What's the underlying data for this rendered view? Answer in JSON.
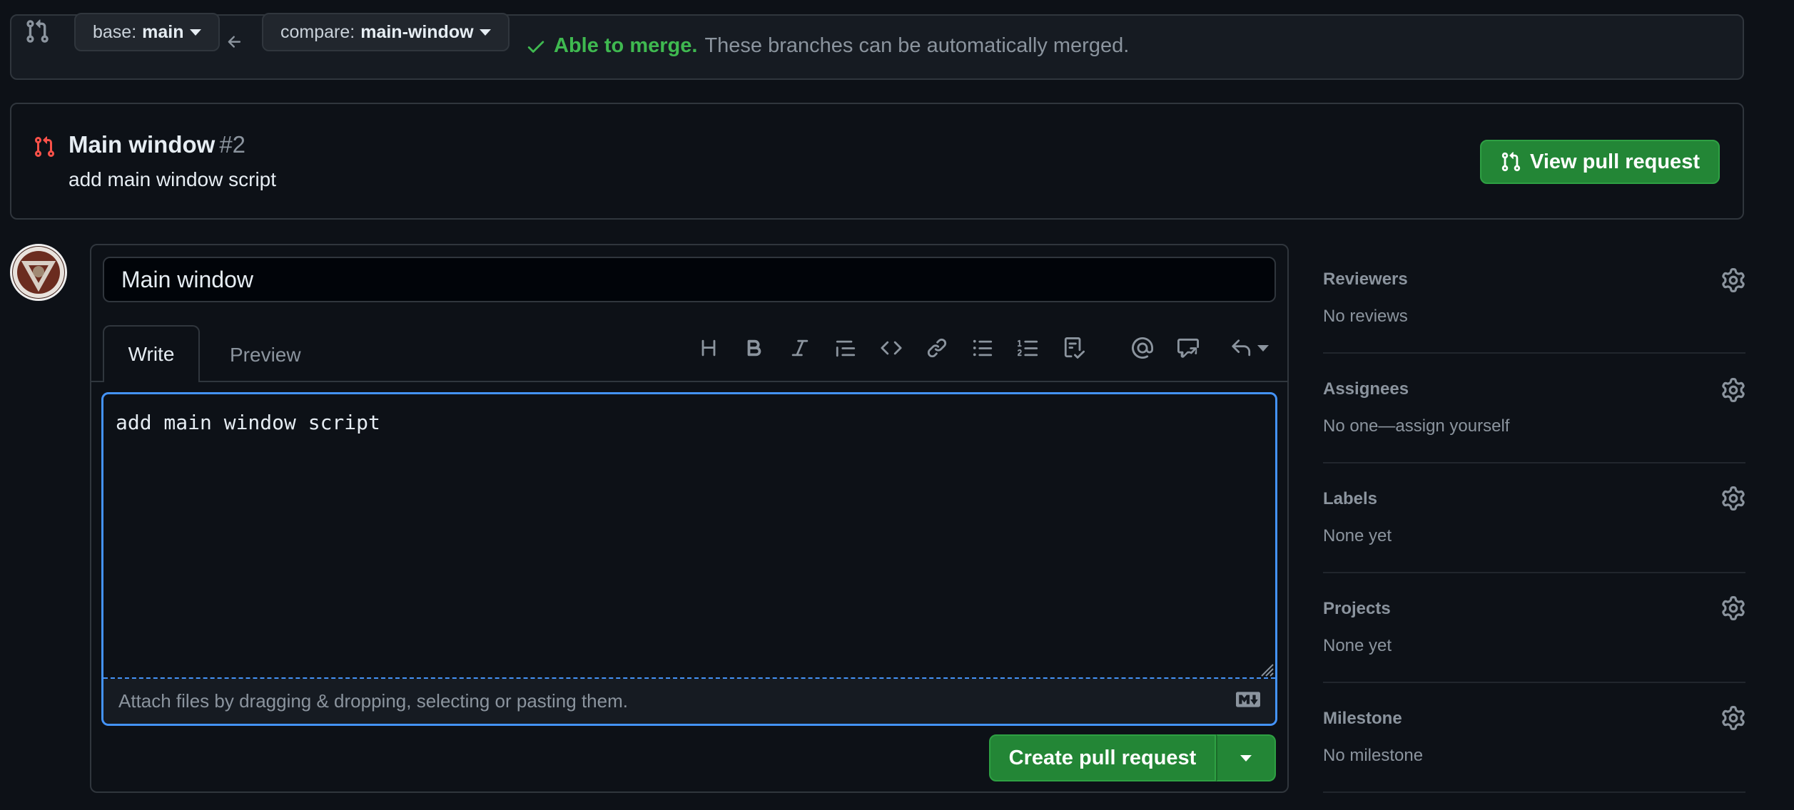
{
  "compare_bar": {
    "base_prefix": "base:",
    "base_branch": "main",
    "compare_prefix": "compare:",
    "compare_branch": "main-window",
    "merge_ok": "Able to merge.",
    "merge_msg": "These branches can be automatically merged."
  },
  "existing_pr": {
    "title": "Main window",
    "number": "#2",
    "description": "add main window script",
    "view_button": "View pull request"
  },
  "form": {
    "title_value": "Main window",
    "tabs": [
      "Write",
      "Preview"
    ],
    "toolbar": [
      "heading-icon",
      "bold-icon",
      "italic-icon",
      "quote-icon",
      "code-icon",
      "link-icon",
      "bulleted-list-icon",
      "numbered-list-icon",
      "task-list-icon",
      "mention-icon",
      "reference-icon",
      "reply-icon"
    ],
    "body_value": "add main window script",
    "attach_text": "Attach files by dragging & dropping, selecting or pasting them.",
    "create_button": "Create pull request"
  },
  "sidebar": [
    {
      "title": "Reviewers",
      "value": "No reviews"
    },
    {
      "title": "Assignees",
      "value": "No one—assign yourself"
    },
    {
      "title": "Labels",
      "value": "None yet"
    },
    {
      "title": "Projects",
      "value": "None yet"
    },
    {
      "title": "Milestone",
      "value": "No milestone"
    }
  ],
  "colors": {
    "background": "#0d1117",
    "border": "#30363d",
    "success": "#3fb950",
    "primary_button": "#238636",
    "focus": "#4493f8",
    "closed_pr": "#f85149"
  }
}
